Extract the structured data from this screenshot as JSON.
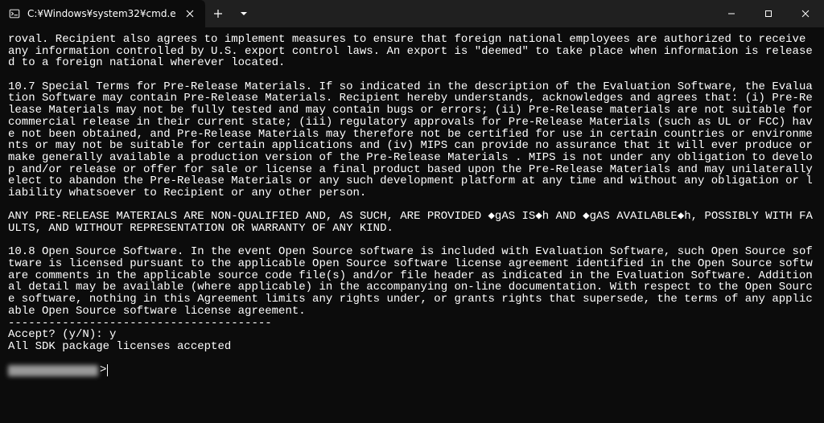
{
  "window": {
    "tab_title": "C:¥Windows¥system32¥cmd.e"
  },
  "terminal": {
    "paragraphs": [
      "roval. Recipient also agrees to implement measures to ensure that foreign national employees are authorized to receive any information controlled by U.S. export control laws. An export is \"deemed\" to take place when information is released to a foreign national wherever located.",
      "",
      "10.7 Special Terms for Pre-Release Materials. If so indicated in the description of the Evaluation Software, the Evaluation Software may contain Pre-Release Materials. Recipient hereby understands, acknowledges and agrees that: (i) Pre-Release Materials may not be fully tested and may contain bugs or errors; (ii) Pre-Release materials are not suitable for commercial release in their current state; (iii) regulatory approvals for Pre-Release Materials (such as UL or FCC) have not been obtained, and Pre-Release Materials may therefore not be certified for use in certain countries or environments or may not be suitable for certain applications and (iv) MIPS can provide no assurance that it will ever produce or make generally available a production version of the Pre-Release Materials . MIPS is not under any obligation to develop and/or release or offer for sale or license a final product based upon the Pre-Release Materials and may unilaterally elect to abandon the Pre-Release Materials or any such development platform at any time and without any obligation or liability whatsoever to Recipient or any other person.",
      "",
      "ANY PRE-RELEASE MATERIALS ARE NON-QUALIFIED AND, AS SUCH, ARE PROVIDED ◆gAS IS◆h AND ◆gAS AVAILABLE◆h, POSSIBLY WITH FAULTS, AND WITHOUT REPRESENTATION OR WARRANTY OF ANY KIND.",
      "",
      "10.8 Open Source Software. In the event Open Source software is included with Evaluation Software, such Open Source software is licensed pursuant to the applicable Open Source software license agreement identified in the Open Source software comments in the applicable source code file(s) and/or file header as indicated in the Evaluation Software. Additional detail may be available (where applicable) in the accompanying on-line documentation. With respect to the Open Source software, nothing in this Agreement limits any rights under, or grants rights that supersede, the terms of any applicable Open Source software license agreement.",
      "---------------------------------------",
      "Accept? (y/N): y",
      "All SDK package licenses accepted",
      ""
    ]
  }
}
